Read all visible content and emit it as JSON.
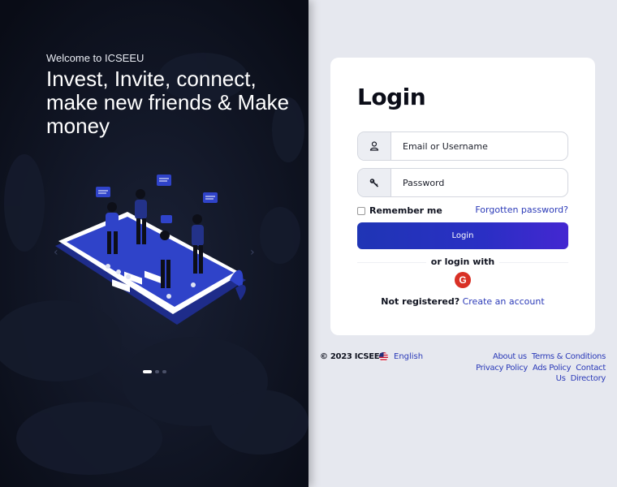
{
  "hero": {
    "welcome": "Welcome to ICSEEU",
    "headline": "Invest, Invite, connect, make new friends & Make money",
    "slide_count": 3,
    "active_slide": 1
  },
  "login": {
    "title": "Login",
    "email_placeholder": "Email or Username",
    "password_placeholder": "Password",
    "remember_label": "Remember me",
    "forgot_label": "Forgotten password?",
    "submit_label": "Login",
    "or_label": "or login with",
    "google_glyph": "G",
    "register_question": "Not registered?",
    "register_link": "Create an account"
  },
  "footer": {
    "copyright": "© 2023 ICSEEU",
    "language": "English",
    "links": [
      "About us",
      "Terms & Conditions",
      "Privacy Policy",
      "Ads Policy",
      "Contact Us",
      "Directory"
    ]
  },
  "colors": {
    "accent": "#2b3ab8",
    "button_start": "#1f35b5",
    "button_end": "#4427d1",
    "hero_bg": "#0e1322",
    "page_bg": "#e6e8ef",
    "google": "#d93025"
  },
  "icons": {
    "email": "user-icon",
    "password": "key-icon",
    "social": "google-icon",
    "language": "us-flag-icon"
  }
}
